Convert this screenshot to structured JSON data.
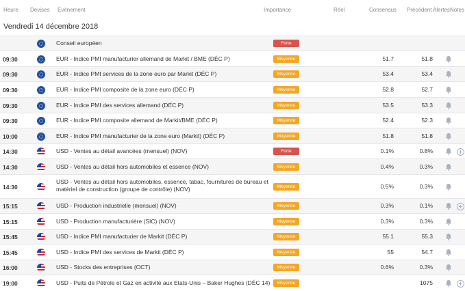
{
  "columns": {
    "time": "Heure",
    "currency": "Devises",
    "event": "Evènement",
    "importance": "Importance",
    "actual": "Réel",
    "consensus": "Consensus",
    "previous": "Précédent",
    "alerts": "Alertes",
    "notes": "Notes"
  },
  "date_label": "Vendredi 14 décembre 2018",
  "colors": {
    "forte": "#d9534f",
    "moyenne": "#f5a623"
  },
  "rows": [
    {
      "time": "",
      "flag": "eu-flag-icon",
      "event": "Conseil européen",
      "importance": "Forte",
      "consensus": "",
      "previous": "",
      "bell": false,
      "plus": false
    },
    {
      "time": "09:30",
      "flag": "eu-flag-icon",
      "event": "EUR - Indice PMI manufacturier allemand de Markit / BME (DÉC P)",
      "importance": "Moyenne",
      "consensus": "51.7",
      "previous": "51.8",
      "bell": true,
      "plus": false
    },
    {
      "time": "09:30",
      "flag": "eu-flag-icon",
      "event": "EUR - Indice PMI services de la zone euro par Markit (DÉC P)",
      "importance": "Moyenne",
      "consensus": "53.4",
      "previous": "53.4",
      "bell": true,
      "plus": false
    },
    {
      "time": "09:30",
      "flag": "eu-flag-icon",
      "event": "EUR - Indice PMI composite de la zone euro (DÉC P)",
      "importance": "Moyenne",
      "consensus": "52.8",
      "previous": "52.7",
      "bell": true,
      "plus": false
    },
    {
      "time": "09:30",
      "flag": "eu-flag-icon",
      "event": "EUR - Indice PMI des services allemand (DÉC P)",
      "importance": "Moyenne",
      "consensus": "53.5",
      "previous": "53.3",
      "bell": true,
      "plus": false
    },
    {
      "time": "09:30",
      "flag": "eu-flag-icon",
      "event": "EUR - Indice PMI composite allemand de Markit/BME (DÉC P)",
      "importance": "Moyenne",
      "consensus": "52.4",
      "previous": "52.3",
      "bell": true,
      "plus": false
    },
    {
      "time": "10:00",
      "flag": "eu-flag-icon",
      "event": "EUR - Indice PMI manufacturier de la zone euro (Markit) (DÉC P)",
      "importance": "Moyenne",
      "consensus": "51.8",
      "previous": "51.8",
      "bell": true,
      "plus": false
    },
    {
      "time": "14:30",
      "flag": "us-flag-icon",
      "event": "USD - Ventes au détail avancées (mensuel) (NOV)",
      "importance": "Forte",
      "consensus": "0.1%",
      "previous": "0.8%",
      "bell": true,
      "plus": true
    },
    {
      "time": "14:30",
      "flag": "us-flag-icon",
      "event": "USD - Ventes au détail hors automobiles et essence (NOV)",
      "importance": "Moyenne",
      "consensus": "0.4%",
      "previous": "0.3%",
      "bell": true,
      "plus": false
    },
    {
      "time": "14:30",
      "flag": "us-flag-icon",
      "event": "USD - Ventes au détail hors automobiles, essence, tabac, fournitures de bureau et",
      "event2": "matériel de construction (groupe de contrôle) (NOV)",
      "importance": "Moyenne",
      "consensus": "0.5%",
      "previous": "0.3%",
      "bell": true,
      "plus": false
    },
    {
      "time": "15:15",
      "flag": "us-flag-icon",
      "event": "USD - Production industrielle (mensuel) (NOV)",
      "importance": "Moyenne",
      "consensus": "0.3%",
      "previous": "0.1%",
      "bell": true,
      "plus": true
    },
    {
      "time": "15:15",
      "flag": "us-flag-icon",
      "event": "USD - Production manufacturière (SIC) (NOV)",
      "importance": "Moyenne",
      "consensus": "0.3%",
      "previous": "0.3%",
      "bell": true,
      "plus": false
    },
    {
      "time": "15:45",
      "flag": "us-flag-icon",
      "event": "USD - Indice PMI manufacturier de Markit (DÉC P)",
      "importance": "Moyenne",
      "consensus": "55.1",
      "previous": "55.3",
      "bell": true,
      "plus": false
    },
    {
      "time": "15:45",
      "flag": "us-flag-icon",
      "event": "USD - Indice PMI des services de Markit (DÉC P)",
      "importance": "Moyenne",
      "consensus": "55",
      "previous": "54.7",
      "bell": true,
      "plus": false
    },
    {
      "time": "16:00",
      "flag": "us-flag-icon",
      "event": "USD - Stocks des entreprises (OCT)",
      "importance": "Moyenne",
      "consensus": "0.6%",
      "previous": "0.3%",
      "bell": true,
      "plus": false
    },
    {
      "time": "19:00",
      "flag": "us-flag-icon",
      "event": "USD - Puits de Pétrole et Gaz en activité aux Etats-Unis – Baker Hughes (DÉC 14)",
      "importance": "Moyenne",
      "consensus": "",
      "previous": "1075",
      "bell": true,
      "plus": true
    }
  ]
}
